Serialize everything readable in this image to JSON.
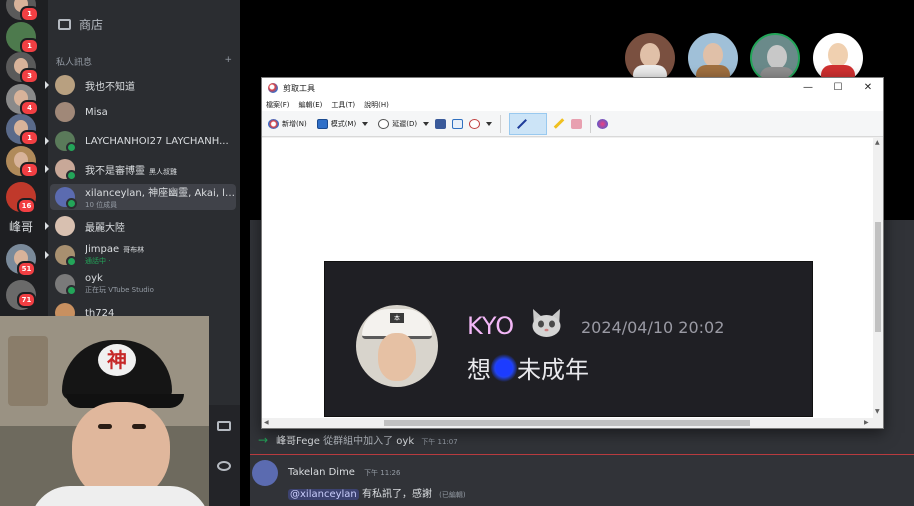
{
  "rail": {
    "badges": [
      "1",
      "1",
      "3",
      "4",
      "1",
      "1",
      "16",
      "51",
      "71"
    ],
    "text": "峰哥"
  },
  "sidebar": {
    "store_label": "商店",
    "dm_header": "私人訊息",
    "add": "+",
    "items": [
      {
        "name": "我也不知道"
      },
      {
        "name": "Misa"
      },
      {
        "name": "LAYCHANHOI27 LAYCHANH..."
      },
      {
        "name": "我不是審博靈",
        "tag": "黑人叔雞"
      },
      {
        "name": "xilanceylan, 神座幽靈, Akai, lo...",
        "sub": "10 位成員"
      },
      {
        "name": "最麗大陸"
      },
      {
        "name": "Jimpae",
        "tag": "哥布林",
        "sub": "通話中 ·"
      },
      {
        "name": "oyk",
        "sub": "正在玩 VTube Studio"
      },
      {
        "name": "th724"
      }
    ]
  },
  "snip": {
    "title": "剪取工具",
    "menu": [
      "檔案(F)",
      "編輯(E)",
      "工具(T)",
      "說明(H)"
    ],
    "toolbar": {
      "new": "新增(N)",
      "mode": "模式(M)",
      "delay": "延遲(D)"
    },
    "min": "—",
    "max": "☐",
    "close": "✕",
    "captured": {
      "username": "KYO",
      "timestamp": "2024/04/10 20:02",
      "text_before": "想",
      "text_after": "未成年"
    }
  },
  "chat": {
    "join": {
      "name": "峰哥Fege",
      "action": "從群組中加入了",
      "target": "oyk",
      "time": "下午 11:07"
    },
    "message": {
      "author": "Takelan Dime",
      "time": "下午 11:26",
      "mention": "@xilanceylan",
      "text": "有私訊了，感謝",
      "edited": "(已編輯)"
    }
  },
  "colors": {
    "accent_green": "#23a559",
    "badge_red": "#f23f43",
    "kyo_pink": "#f3b7f7",
    "scribble_blue": "#1c3cff"
  }
}
